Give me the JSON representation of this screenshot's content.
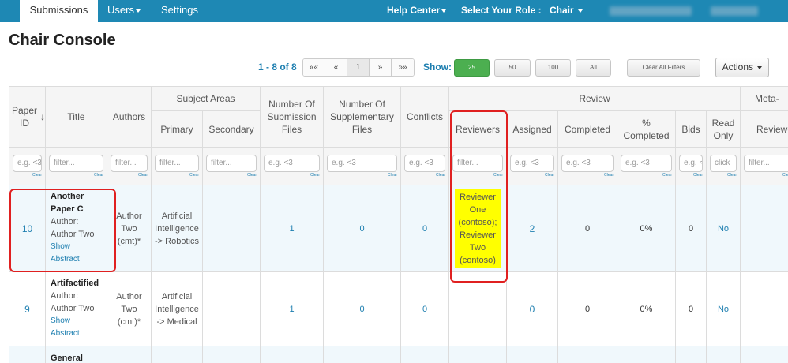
{
  "nav": {
    "submissions": "Submissions",
    "users": "Users",
    "settings": "Settings",
    "help_center": "Help Center",
    "role_label": "Select Your Role :",
    "role_value": "Chair"
  },
  "page_title": "Chair Console",
  "toolbar": {
    "range": "1 - 8 of 8",
    "pager": [
      "««",
      "«",
      "1",
      "»",
      "»»"
    ],
    "show_label": "Show:",
    "page_sizes": [
      "25",
      "50",
      "100",
      "All"
    ],
    "clear_filters": "Clear All Filters",
    "actions": "Actions"
  },
  "groups": {
    "subject_areas": "Subject Areas",
    "review": "Review"
  },
  "columns": {
    "paper_id": "Paper ID",
    "title": "Title",
    "authors": "Authors",
    "primary": "Primary",
    "secondary": "Secondary",
    "num_sub_files": "Number Of Submission Files",
    "num_supp_files": "Number Of Supplementary Files",
    "conflicts": "Conflicts",
    "reviewers": "Reviewers",
    "assigned": "Assigned",
    "completed": "Completed",
    "pct_completed": "% Completed",
    "bids": "Bids",
    "read_only": "Read Only",
    "meta_reviewer": "Meta-Reviewer"
  },
  "filters": {
    "paper_id": "e.g. <3",
    "title": "filter...",
    "authors": "filter...",
    "primary": "filter...",
    "secondary": "filter...",
    "num_sub_files": "e.g. <3",
    "num_supp_files": "e.g. <3",
    "conflicts": "e.g. <3",
    "reviewers": "filter...",
    "assigned": "e.g. <3",
    "completed": "e.g. <3",
    "pct_completed": "e.g. <3",
    "bids": "e.g. <3",
    "read_only": "click",
    "meta_reviewer": "filter...",
    "clear": "Clear"
  },
  "rows": [
    {
      "id": "10",
      "title": "Another Paper C",
      "author_label": "Author:",
      "author_name": "Author Two",
      "show": "Show",
      "abstract": "Abstract",
      "authors": "Author Two (cmt)*",
      "primary": "Artificial Intelligence -> Robotics",
      "secondary": "",
      "sub_files": "1",
      "supp_files": "0",
      "conflicts": "0",
      "reviewers": "Reviewer One (contoso); Reviewer Two (contoso)",
      "assigned": "2",
      "completed": "0",
      "pct_completed": "0%",
      "bids": "0",
      "read_only": "No"
    },
    {
      "id": "9",
      "title": "Artifactified",
      "author_label": "Author:",
      "author_name": "Author Two",
      "show": "Show",
      "abstract": "Abstract",
      "authors": "Author Two (cmt)*",
      "primary": "Artificial Intelligence -> Medical",
      "secondary": "",
      "sub_files": "1",
      "supp_files": "0",
      "conflicts": "0",
      "reviewers": "",
      "assigned": "0",
      "completed": "0",
      "pct_completed": "0%",
      "bids": "0",
      "read_only": "No"
    },
    {
      "title": "General"
    }
  ],
  "colors": {
    "nav_bg": "#1e88b4",
    "link": "#1e7fb0",
    "highlight": "#ffff00",
    "annotation": "#e02020",
    "green": "#4caf50"
  }
}
